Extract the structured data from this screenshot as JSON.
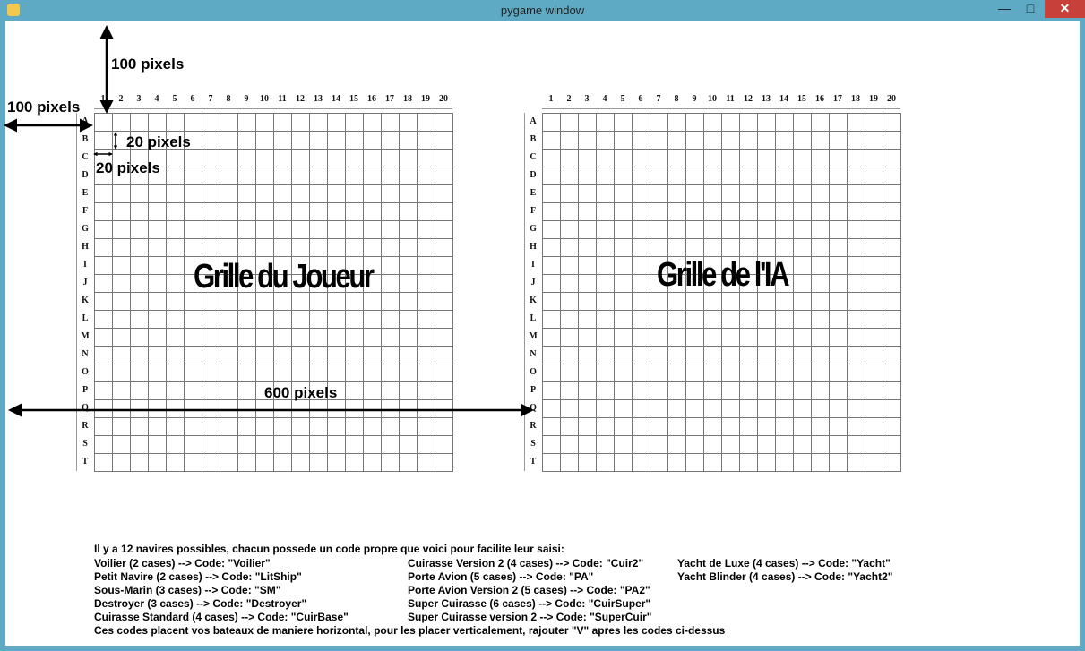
{
  "window": {
    "title": "pygame window"
  },
  "grid": {
    "columns": [
      "1",
      "2",
      "3",
      "4",
      "5",
      "6",
      "7",
      "8",
      "9",
      "10",
      "11",
      "12",
      "13",
      "14",
      "15",
      "16",
      "17",
      "18",
      "19",
      "20"
    ],
    "rows": [
      "A",
      "B",
      "C",
      "D",
      "E",
      "F",
      "G",
      "H",
      "I",
      "J",
      "K",
      "L",
      "M",
      "N",
      "O",
      "P",
      "Q",
      "R",
      "S",
      "T"
    ]
  },
  "labels": {
    "player_grid": "Grille du Joueur",
    "ai_grid": "Grille de l'IA"
  },
  "annotations": {
    "top_offset": "100 pixels",
    "left_offset": "100 pixels",
    "cell_height": "20 pixels",
    "cell_width": "20 pixels",
    "span": "600 pixels"
  },
  "legend": {
    "intro": "Il y a 12 navires possibles, chacun possede un code propre que voici pour facilite leur saisi:",
    "col1": [
      "Voilier (2 cases) --> Code: \"Voilier\"",
      "Petit Navire (2 cases) --> Code: \"LitShip\"",
      "Sous-Marin (3 cases) --> Code: \"SM\"",
      "Destroyer (3 cases) --> Code: \"Destroyer\"",
      "Cuirasse Standard (4 cases) --> Code: \"CuirBase\""
    ],
    "col2": [
      "Cuirasse Version 2 (4 cases) --> Code: \"Cuir2\"",
      "Porte Avion (5 cases) --> Code: \"PA\"",
      "Porte Avion Version 2 (5 cases) --> Code: \"PA2\"",
      "Super Cuirasse (6 cases) --> Code: \"CuirSuper\"",
      "Super Cuirasse version 2 --> Code: \"SuperCuir\""
    ],
    "col3": [
      "Yacht de Luxe (4 cases) --> Code: \"Yacht\"",
      "Yacht Blinder (4 cases) --> Code: \"Yacht2\""
    ],
    "footer": "Ces codes placent vos bateaux de maniere horizontal, pour les placer verticalement, rajouter \"V\" apres les codes ci-dessus"
  }
}
